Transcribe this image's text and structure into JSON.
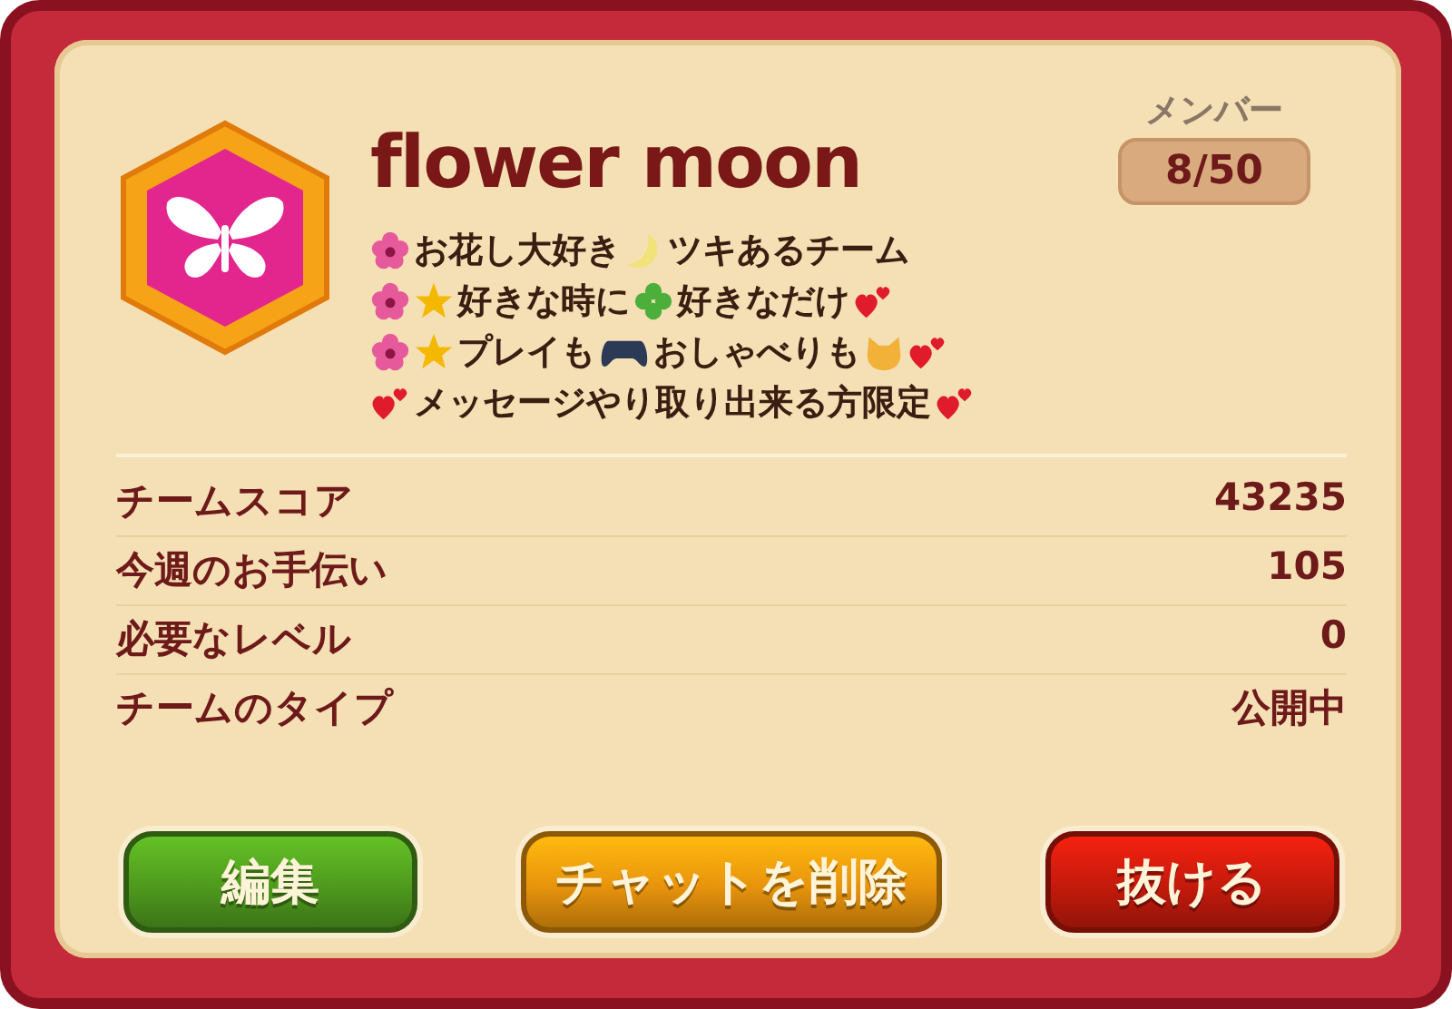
{
  "team": {
    "name": "flower moon",
    "members_label": "メンバー",
    "members": "8/50"
  },
  "description": [
    [
      {
        "kind": "flower"
      },
      {
        "kind": "text",
        "text": "お花し大好き"
      },
      {
        "kind": "moon"
      },
      {
        "kind": "text",
        "text": "ツキあるチーム"
      }
    ],
    [
      {
        "kind": "flower"
      },
      {
        "kind": "star"
      },
      {
        "kind": "text",
        "text": "好きな時に"
      },
      {
        "kind": "clover"
      },
      {
        "kind": "text",
        "text": "好きなだけ"
      },
      {
        "kind": "hearts"
      }
    ],
    [
      {
        "kind": "flower"
      },
      {
        "kind": "star"
      },
      {
        "kind": "text",
        "text": "プレイも"
      },
      {
        "kind": "gamepad"
      },
      {
        "kind": "text",
        "text": "おしゃべりも"
      },
      {
        "kind": "cat"
      },
      {
        "kind": "hearts"
      }
    ],
    [
      {
        "kind": "hearts"
      },
      {
        "kind": "text",
        "text": "メッセージやり取り出来る方限定"
      },
      {
        "kind": "hearts"
      }
    ]
  ],
  "stats": [
    {
      "label": "チームスコア",
      "value": "43235"
    },
    {
      "label": "今週のお手伝い",
      "value": "105"
    },
    {
      "label": "必要なレベル",
      "value": "0"
    },
    {
      "label": "チームのタイプ",
      "value": "公開中"
    }
  ],
  "buttons": [
    {
      "label": "編集",
      "color": "#4f9a1e"
    },
    {
      "label": "チャットを削除",
      "color": "#e8940c"
    },
    {
      "label": "抜ける",
      "color": "#c41a0c"
    }
  ]
}
